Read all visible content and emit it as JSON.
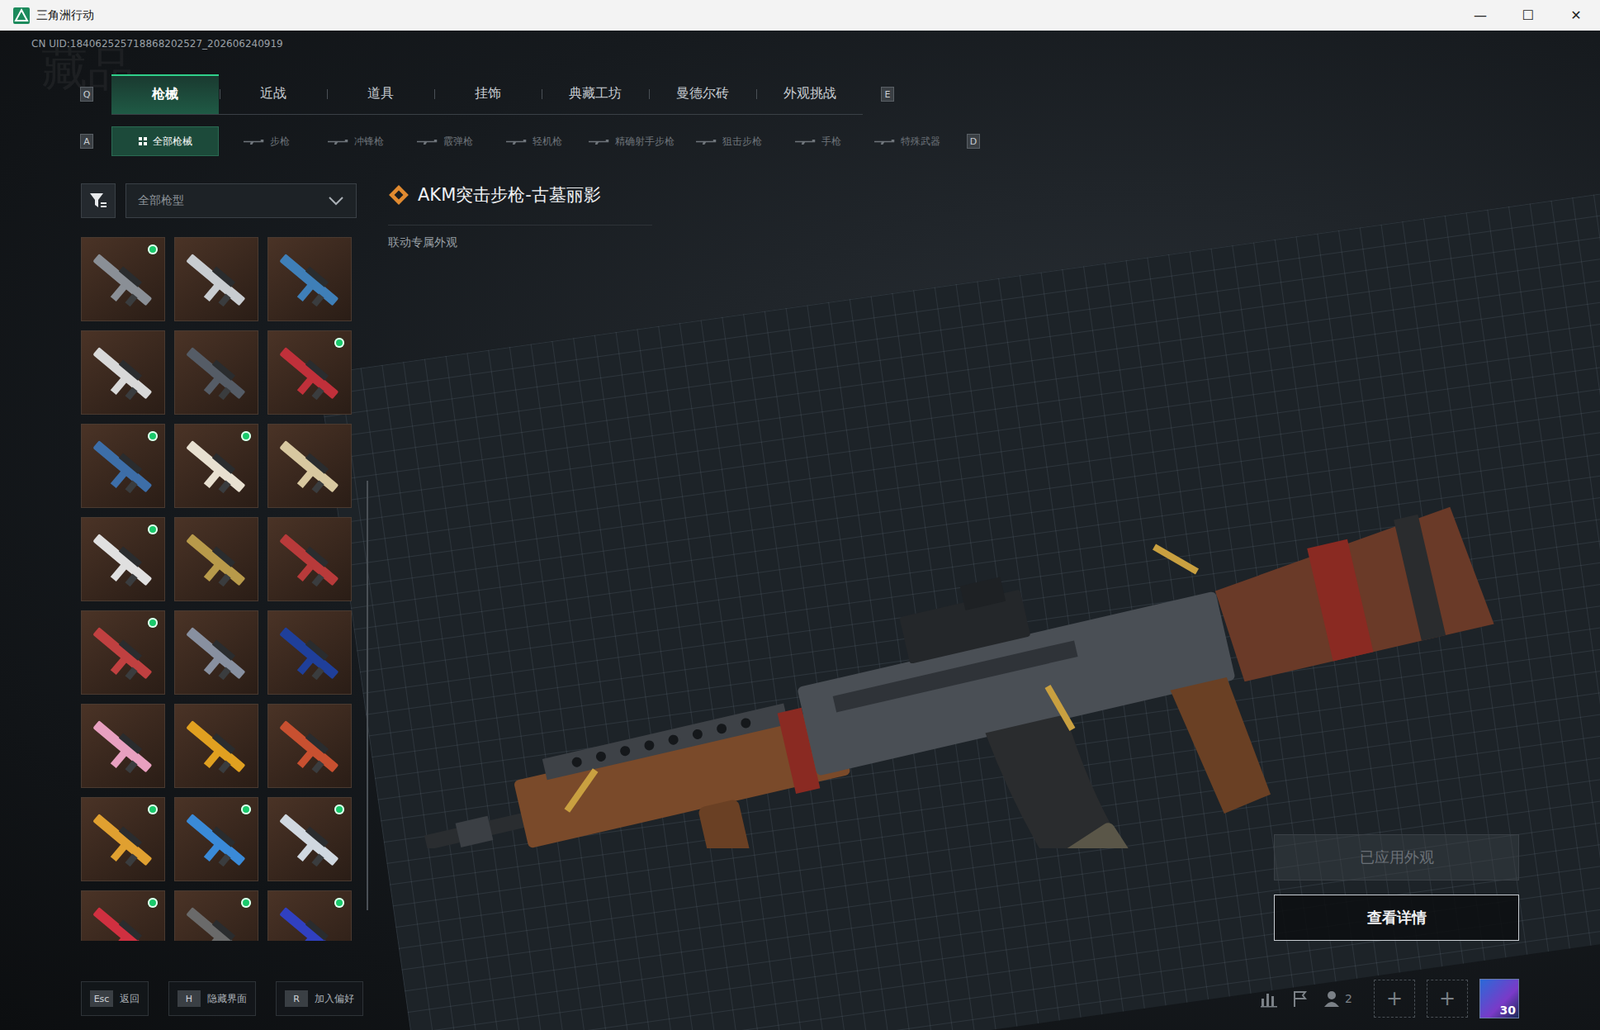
{
  "window": {
    "title": "三角洲行动",
    "controls": [
      "—",
      "☐",
      "✕"
    ]
  },
  "uid": "CN UID:184062525718868202527_202606240919",
  "watermark": "藏品",
  "tabs": {
    "prev_key": "Q",
    "next_key": "E",
    "items": [
      {
        "label": "枪械",
        "selected": true
      },
      {
        "label": "近战",
        "selected": false
      },
      {
        "label": "道具",
        "selected": false
      },
      {
        "label": "挂饰",
        "selected": false
      },
      {
        "label": "典藏工坊",
        "selected": false
      },
      {
        "label": "曼德尔砖",
        "selected": false
      },
      {
        "label": "外观挑战",
        "selected": false
      }
    ]
  },
  "subtabs": {
    "prev_key": "A",
    "next_key": "D",
    "items": [
      {
        "label": "全部枪械",
        "selected": true
      },
      {
        "label": "步枪",
        "selected": false
      },
      {
        "label": "冲锋枪",
        "selected": false
      },
      {
        "label": "霰弹枪",
        "selected": false
      },
      {
        "label": "轻机枪",
        "selected": false
      },
      {
        "label": "精确射手步枪",
        "selected": false
      },
      {
        "label": "狙击步枪",
        "selected": false
      },
      {
        "label": "手枪",
        "selected": false
      },
      {
        "label": "特殊武器",
        "selected": false
      }
    ]
  },
  "filter": {
    "label": "全部枪型"
  },
  "skin": {
    "name": "AKM突击步枪-古墓丽影",
    "tag": "联动专属外观"
  },
  "thumbnails": [
    {
      "owned": true,
      "selected": false,
      "color": "#8a8f96"
    },
    {
      "owned": false,
      "selected": false,
      "color": "#c8ccd0"
    },
    {
      "owned": false,
      "selected": false,
      "color": "#3f7fb8"
    },
    {
      "owned": false,
      "selected": false,
      "color": "#d8d8d8"
    },
    {
      "owned": false,
      "selected": false,
      "color": "#555c66"
    },
    {
      "owned": true,
      "selected": false,
      "color": "#c0303a"
    },
    {
      "owned": true,
      "selected": false,
      "color": "#3d6ea8"
    },
    {
      "owned": true,
      "selected": false,
      "color": "#e8e0d0"
    },
    {
      "owned": false,
      "selected": false,
      "color": "#d8c8a0"
    },
    {
      "owned": true,
      "selected": false,
      "color": "#e0e0e0"
    },
    {
      "owned": false,
      "selected": false,
      "color": "#b89a4a"
    },
    {
      "owned": false,
      "selected": false,
      "color": "#b83a3a"
    },
    {
      "owned": true,
      "selected": false,
      "color": "#c04040"
    },
    {
      "owned": false,
      "selected": false,
      "color": "#8890a0"
    },
    {
      "owned": false,
      "selected": false,
      "color": "#1f3f9a"
    },
    {
      "owned": false,
      "selected": false,
      "color": "#e8a0c0"
    },
    {
      "owned": false,
      "selected": false,
      "color": "#e0a020"
    },
    {
      "owned": false,
      "selected": false,
      "color": "#c85030"
    },
    {
      "owned": true,
      "selected": false,
      "color": "#e0a030"
    },
    {
      "owned": true,
      "selected": false,
      "color": "#3a8ad8"
    },
    {
      "owned": true,
      "selected": false,
      "color": "#d0d8e0"
    },
    {
      "owned": true,
      "selected": false,
      "color": "#d03040"
    },
    {
      "owned": true,
      "selected": false,
      "color": "#6a6a6a"
    },
    {
      "owned": true,
      "selected": false,
      "color": "#3040c0"
    }
  ],
  "buttons": [
    {
      "label": "已应用外观",
      "disabled": true
    },
    {
      "label": "查看详情",
      "disabled": false
    }
  ],
  "hints": [
    {
      "key": "Esc",
      "label": "返回"
    },
    {
      "key": "H",
      "label": "隐藏界面"
    },
    {
      "key": "R",
      "label": "加入偏好"
    }
  ],
  "status": {
    "friends": "2",
    "add": [
      "+",
      "+"
    ],
    "level": "30"
  }
}
